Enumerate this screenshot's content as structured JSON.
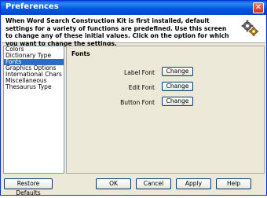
{
  "window": {
    "title": "Preferences",
    "close_glyph": "✕"
  },
  "header": {
    "text": "When Word Search Construction Kit is first installed, default settings for a variety of functions are predefined.  Use this screen to change any of these initial values.  Click on the option for which you want to change the settings.",
    "icon": "gear-icon"
  },
  "categories": [
    "Colors",
    "Dictionary Type",
    "Fonts",
    "Graphics Options",
    "International Chars",
    "Miscellaneous",
    "Thesaurus Type"
  ],
  "selected_category": "Fonts",
  "panel": {
    "title": "Fonts",
    "rows": [
      {
        "label": "Label Font",
        "button": "Change"
      },
      {
        "label": "Edit Font",
        "button": "Change"
      },
      {
        "label": "Button Font",
        "button": "Change"
      }
    ]
  },
  "buttons": {
    "restore": "Restore Defaults",
    "ok": "OK",
    "cancel": "Cancel",
    "apply": "Apply",
    "help": "Help"
  },
  "colors": {
    "title_bar": "#0558e0",
    "selection": "#316ac5",
    "dialog_bg": "#ece9d8"
  }
}
